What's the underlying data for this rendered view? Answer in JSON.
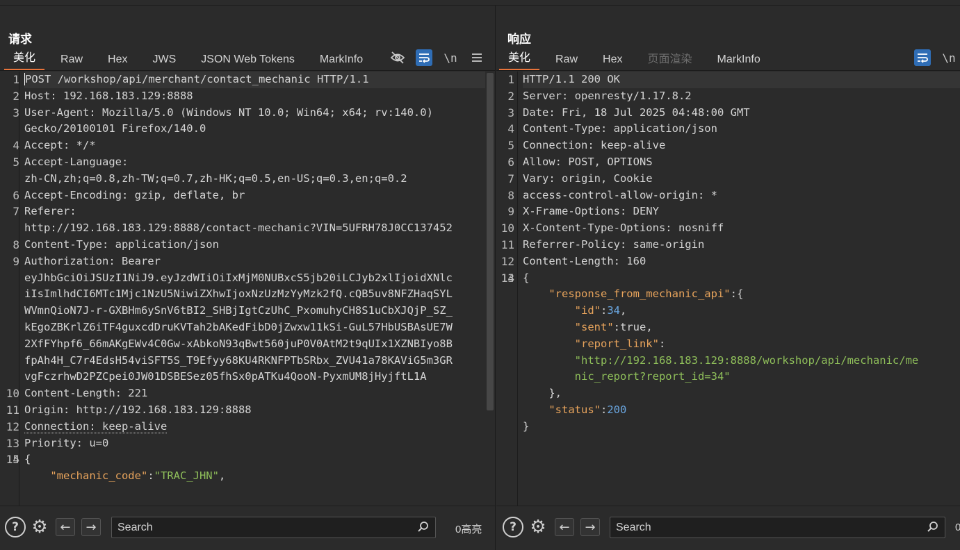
{
  "request": {
    "title": "请求",
    "tabs": [
      "美化",
      "Raw",
      "Hex",
      "JWS",
      "JSON Web Tokens",
      "MarkInfo"
    ],
    "active_tab": "美化",
    "icons": {
      "hide": "eye-off-icon",
      "wrap": "wrap-icon",
      "newline": "\\n",
      "menu": "menu-icon"
    },
    "lines": [
      {
        "n": "1",
        "text": "POST /workshop/api/merchant/contact_mechanic HTTP/1.1"
      },
      {
        "n": "2",
        "text": "Host: 192.168.183.129:8888"
      },
      {
        "n": "3",
        "text": "User-Agent: Mozilla/5.0 (Windows NT 10.0; Win64; x64; rv:140.0)"
      },
      {
        "n": "",
        "text": "Gecko/20100101 Firefox/140.0"
      },
      {
        "n": "4",
        "text": "Accept: */*"
      },
      {
        "n": "5",
        "text": "Accept-Language:"
      },
      {
        "n": "",
        "text": "zh-CN,zh;q=0.8,zh-TW;q=0.7,zh-HK;q=0.5,en-US;q=0.3,en;q=0.2"
      },
      {
        "n": "6",
        "text": "Accept-Encoding: gzip, deflate, br"
      },
      {
        "n": "7",
        "text": "Referer:"
      },
      {
        "n": "",
        "text": "http://192.168.183.129:8888/contact-mechanic?VIN=5UFRH78J0CC137452"
      },
      {
        "n": "8",
        "text": "Content-Type: application/json"
      },
      {
        "n": "9",
        "text": "Authorization: Bearer"
      },
      {
        "n": "",
        "text": "eyJhbGciOiJSUzI1NiJ9.eyJzdWIiOiIxMjM0NUBxcS5jb20iLCJyb2xlIjoidXNlc"
      },
      {
        "n": "",
        "text": "iIsImlhdCI6MTc1Mjc1NzU5NiwiZXhwIjoxNzUzMzYyMzk2fQ.cQB5uv8NFZHaqSYL"
      },
      {
        "n": "",
        "text": "WVmnQioN7J-r-GXBHm6ySnV6tBI2_SHBjIgtCzUhC_PxomuhyCH8S1uCbXJQjP_SZ_"
      },
      {
        "n": "",
        "text": "kEgoZBKrlZ6iTF4guxcdDruKVTah2bAKedFibD0jZwxw11kSi-GuL57HbUSBAsUE7W"
      },
      {
        "n": "",
        "text": "2XfFYhpf6_66mAKgEWv4C0Gw-xAbkoN93qBwt560juP0V0AtM2t9qUIx1XZNBIyo8B"
      },
      {
        "n": "",
        "text": "fpAh4H_C7r4EdsH54viSFT5S_T9Efyy68KU4RKNFPTbSRbx_ZVU41a78KAViG5m3GR"
      },
      {
        "n": "",
        "text": "vgFczrhwD2PZCpei0JW01DSBESez05fhSx0pATKu4QooN-PyxmUM8jHyjftL1A"
      },
      {
        "n": "10",
        "text": "Content-Length: 221"
      },
      {
        "n": "11",
        "text": "Origin: http://192.168.183.129:8888"
      },
      {
        "n": "12",
        "text": "Connection: keep-alive"
      },
      {
        "n": "13",
        "text": "Priority: u=0"
      },
      {
        "n": "14",
        "text": ""
      },
      {
        "n": "15",
        "text": "{"
      },
      {
        "n": "",
        "text": "    \"mechanic_code\":\"TRAC_JHN\","
      }
    ],
    "search_placeholder": "Search",
    "highlight_count": "0高亮"
  },
  "response": {
    "title": "响应",
    "tabs": [
      "美化",
      "Raw",
      "Hex",
      "页面渲染",
      "MarkInfo"
    ],
    "active_tab": "美化",
    "disabled_tab": "页面渲染",
    "icons": {
      "wrap": "wrap-icon",
      "newline": "\\n"
    },
    "lines": [
      {
        "n": "1",
        "text": "HTTP/1.1 200 OK"
      },
      {
        "n": "2",
        "text": "Server: openresty/1.17.8.2"
      },
      {
        "n": "3",
        "text": "Date: Fri, 18 Jul 2025 04:48:00 GMT"
      },
      {
        "n": "4",
        "text": "Content-Type: application/json"
      },
      {
        "n": "5",
        "text": "Connection: keep-alive"
      },
      {
        "n": "6",
        "text": "Allow: POST, OPTIONS"
      },
      {
        "n": "7",
        "text": "Vary: origin, Cookie"
      },
      {
        "n": "8",
        "text": "access-control-allow-origin: *"
      },
      {
        "n": "9",
        "text": "X-Frame-Options: DENY"
      },
      {
        "n": "10",
        "text": "X-Content-Type-Options: nosniff"
      },
      {
        "n": "11",
        "text": "Referrer-Policy: same-origin"
      },
      {
        "n": "12",
        "text": "Content-Length: 160"
      },
      {
        "n": "13",
        "text": ""
      },
      {
        "n": "14",
        "text": "{"
      }
    ],
    "json": {
      "k_root": "\"response_from_mechanic_api\"",
      "k_id": "\"id\"",
      "v_id": "34",
      "k_sent": "\"sent\"",
      "v_sent": "true",
      "k_link": "\"report_link\"",
      "v_link1": "\"http://192.168.183.129:8888/workshop/api/mechanic/me",
      "v_link2": "nic_report?report_id=34\"",
      "k_status": "\"status\"",
      "v_status": "200"
    },
    "search_placeholder": "Search",
    "highlight_count": "0"
  },
  "colors": {
    "accent": "#e8743b",
    "active_button": "#2f6db5",
    "json_key": "#e8a45c",
    "json_string": "#8fbf5a",
    "json_number": "#6aa6e0"
  }
}
